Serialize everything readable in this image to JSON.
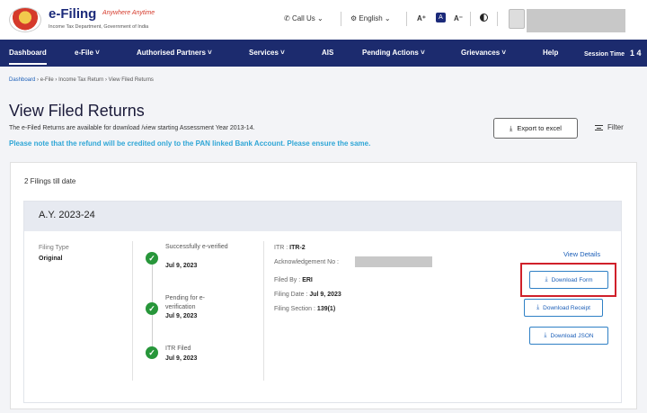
{
  "header": {
    "logo_title": "e-Filing",
    "logo_tagline": "Anywhere Anytime",
    "logo_subtitle": "Income Tax Department, Government of India",
    "call_us": "Call Us",
    "language": "English",
    "font_increase": "A⁺",
    "font_default": "A",
    "font_decrease": "A⁻"
  },
  "nav": {
    "items": [
      "Dashboard",
      "e-File",
      "Authorised Partners",
      "Services",
      "AIS",
      "Pending Actions",
      "Grievances",
      "Help"
    ],
    "session_label": "Session Time",
    "session_value": "1 4"
  },
  "breadcrumb": [
    "Dashboard",
    "e-File",
    "Income Tax Return",
    "View Filed Returns"
  ],
  "page": {
    "title": "View Filed Returns",
    "subtitle": "The e-Filed Returns are available for download /view starting Assessment Year 2013-14.",
    "notice": "Please note that the refund will be credited only to the PAN linked Bank Account. Please ensure the same.",
    "export_label": "Export to excel",
    "filter_label": "Filter"
  },
  "filings_count": "2 Filings till date",
  "filing": {
    "ay": "A.Y. 2023-24",
    "type_label": "Filing Type",
    "type_value": "Original",
    "timeline": [
      {
        "label": "Successfully e-verified",
        "date": "Jul 9, 2023"
      },
      {
        "label": "Pending for e-verification",
        "date": "Jul 9, 2023"
      },
      {
        "label": "ITR Filed",
        "date": "Jul 9, 2023"
      }
    ],
    "details": {
      "itr_label": "ITR :",
      "itr_value": "ITR-2",
      "ack_label": "Acknowledgement No :",
      "filed_by_label": "Filed By :",
      "filed_by_value": "ERI",
      "filing_date_label": "Filing Date :",
      "filing_date_value": "Jul 9, 2023",
      "section_label": "Filing Section :",
      "section_value": "139(1)"
    },
    "actions": {
      "view_details": "View Details",
      "download_form": "Download Form",
      "download_receipt": "Download Receipt",
      "download_json": "Download JSON"
    }
  },
  "colors": {
    "nav_bg": "#1c2b6e",
    "notice": "#2fa6d6",
    "success": "#27963a",
    "highlight": "#d0202a",
    "link": "#1c5fb8"
  }
}
